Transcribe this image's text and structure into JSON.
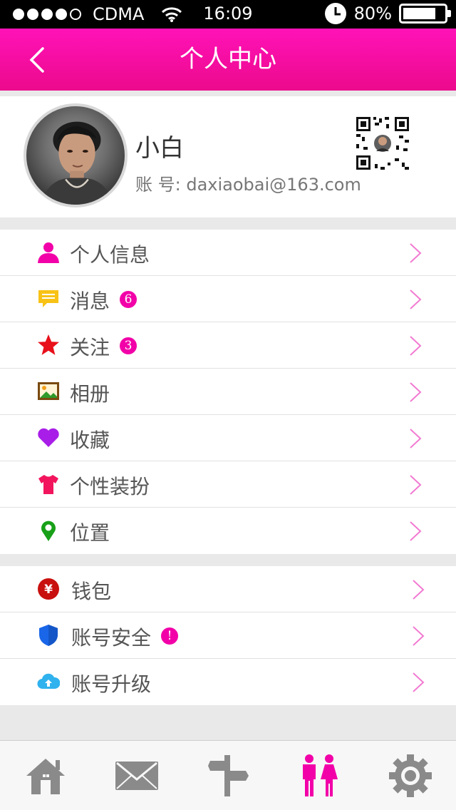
{
  "status_bar": {
    "carrier": "CDMA",
    "time": "16:09",
    "battery_percent_label": "80%",
    "battery_level": 0.8,
    "signal_bars_filled": 4,
    "signal_bars_total": 5
  },
  "header": {
    "title": "个人中心"
  },
  "profile": {
    "name": "小白",
    "account": "账 号: daxiaobai@163.com"
  },
  "menu_group_1": [
    {
      "label": "个人信息",
      "icon": "person-icon",
      "badge": ""
    },
    {
      "label": "消息",
      "icon": "message-icon",
      "badge": "6"
    },
    {
      "label": "关注",
      "icon": "star-icon",
      "badge": "3"
    },
    {
      "label": "相册",
      "icon": "photo-album-icon",
      "badge": ""
    },
    {
      "label": "收藏",
      "icon": "heart-icon",
      "badge": ""
    },
    {
      "label": "个性装扮",
      "icon": "tshirt-icon",
      "badge": ""
    },
    {
      "label": "位置",
      "icon": "location-pin-icon",
      "badge": ""
    }
  ],
  "menu_group_2": [
    {
      "label": "钱包",
      "icon": "wallet-yen-icon",
      "badge": ""
    },
    {
      "label": "账号安全",
      "icon": "shield-icon",
      "badge": "!"
    },
    {
      "label": "账号升级",
      "icon": "cloud-upload-icon",
      "badge": ""
    }
  ],
  "tab_bar": [
    {
      "icon": "home-icon",
      "active": false
    },
    {
      "icon": "mail-icon",
      "active": false
    },
    {
      "icon": "signpost-icon",
      "active": false
    },
    {
      "icon": "couple-icon",
      "active": true
    },
    {
      "icon": "settings-gear-icon",
      "active": false
    }
  ],
  "colors": {
    "accent": "#f200a8",
    "header_top": "#ff12b8",
    "header_bottom": "#ec0a8c",
    "chevron": "#f27bd2",
    "tab_inactive": "#8a8a8a",
    "tab_active": "#f200a8"
  }
}
